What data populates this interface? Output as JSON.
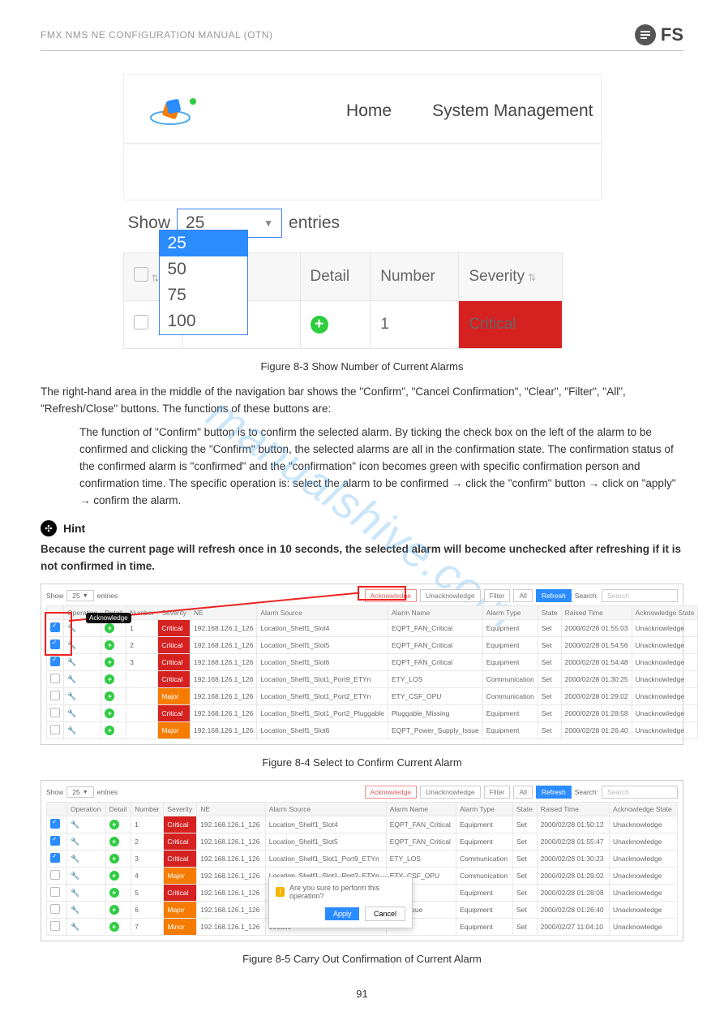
{
  "header": {
    "title": "FMX NMS NE CONFIGURATION MANUAL (OTN)",
    "brand": "FS"
  },
  "fig3": {
    "nav": {
      "home": "Home",
      "system": "System Management"
    },
    "show": {
      "prefix": "Show",
      "suffix": "entries",
      "selected": "25",
      "options": [
        "25",
        "50",
        "75",
        "100"
      ]
    },
    "table": {
      "headers": {
        "op": "on",
        "detail": "Detail",
        "number": "Number",
        "severity": "Severity"
      },
      "row": {
        "number": "1",
        "severity": "Critical"
      }
    },
    "caption": "Figure 8-3 Show Number of Current Alarms"
  },
  "para1": "The right-hand area in the middle of the navigation bar shows the \"Confirm\", \"Cancel Confirmation\", \"Clear\", \"Filter\", \"All\", \"Refresh/Close\" buttons. The functions of these buttons are:",
  "para2": "The function of \"Confirm\" button is to confirm the selected alarm. By ticking the check box on the left of the alarm to be confirmed and clicking the \"Confirm\" button, the selected alarms are all in the confirmation state. The confirmation status of the confirmed alarm is \"confirmed\" and the \"confirmation\" icon becomes green with specific confirmation person and confirmation time. The specific operation is: select the alarm to be confirmed → click the \"confirm\" button → click on \"apply\" → confirm the alarm.",
  "hint": {
    "label": "Hint",
    "text": "Because the current page will refresh once in 10 seconds, the selected alarm will become unchecked after refreshing if it is not confirmed in time."
  },
  "toolbar": {
    "show": "Show",
    "entries": "entries",
    "sel": "25",
    "ack": "Acknowledge",
    "unack": "Unacknowledge",
    "filter": "Filter",
    "all": "All",
    "refresh": "Refresh",
    "search": "Search:",
    "ph": "Search"
  },
  "wheaders": [
    "",
    "Operation",
    "Detail",
    "Number",
    "Severity",
    "NE",
    "Alarm Source",
    "Alarm Name",
    "Alarm Type",
    "State",
    "Raised Time",
    "Acknowledge State"
  ],
  "tooltip": "Acknowledge",
  "fig4": {
    "rows": [
      {
        "chk": true,
        "num": "1",
        "sev": "Critical",
        "sc": "sev-critical",
        "ne": "192.168.126.1_126",
        "src": "Location_Shelf1_Slot4",
        "name": "EQPT_FAN_Critical",
        "type": "Equipment",
        "state": "Set",
        "time": "2000/02/28 01:55:03",
        "ack": "Unacknowledge"
      },
      {
        "chk": true,
        "num": "2",
        "sev": "Critical",
        "sc": "sev-critical",
        "ne": "192.168.126.1_126",
        "src": "Location_Shelf1_Slot5",
        "name": "EQPT_FAN_Critical",
        "type": "Equipment",
        "state": "Set",
        "time": "2000/02/28 01:54:56",
        "ack": "Unacknowledge"
      },
      {
        "chk": true,
        "num": "3",
        "sev": "Critical",
        "sc": "sev-critical",
        "ne": "192.168.126.1_126",
        "src": "Location_Shelf1_Slot6",
        "name": "EQPT_FAN_Critical",
        "type": "Equipment",
        "state": "Set",
        "time": "2000/02/28 01:54:48",
        "ack": "Unacknowledge"
      },
      {
        "chk": false,
        "num": "",
        "sev": "Critical",
        "sc": "sev-critical",
        "ne": "192.168.126.1_126",
        "src": "Location_Shelf1_Slot1_Port9_ETYn",
        "name": "ETY_LOS",
        "type": "Communication",
        "state": "Set",
        "time": "2000/02/28 01:30:25",
        "ack": "Unacknowledge"
      },
      {
        "chk": false,
        "num": "",
        "sev": "Major",
        "sc": "sev-major",
        "ne": "192.168.126.1_126",
        "src": "Location_Shelf1_Slot1_Port2_ETYn",
        "name": "ETY_CSF_OPU",
        "type": "Communication",
        "state": "Set",
        "time": "2000/02/28 01:29:02",
        "ack": "Unacknowledge"
      },
      {
        "chk": false,
        "num": "",
        "sev": "Critical",
        "sc": "sev-critical",
        "ne": "192.168.126.1_126",
        "src": "Location_Shelf1_Slot1_Port2_Pluggable",
        "name": "Pluggable_Missing",
        "type": "Equipment",
        "state": "Set",
        "time": "2000/02/28 01:28:58",
        "ack": "Unacknowledge"
      },
      {
        "chk": false,
        "num": "",
        "sev": "Major",
        "sc": "sev-major",
        "ne": "192.168.126.1_126",
        "src": "Location_Shelf1_Slot6",
        "name": "EQPT_Power_Supply_Issue",
        "type": "Equipment",
        "state": "Set",
        "time": "2000/02/28 01:26:40",
        "ack": "Unacknowledge"
      }
    ],
    "caption": "Figure 8-4 Select to Confirm Current Alarm"
  },
  "fig5": {
    "rows": [
      {
        "chk": true,
        "num": "1",
        "sev": "Critical",
        "sc": "sev-critical",
        "ne": "192.168.126.1_126",
        "src": "Location_Shelf1_Slot4",
        "name": "EQPT_FAN_Critical",
        "type": "Equipment",
        "state": "Set",
        "time": "2000/02/28 01:50:12",
        "ack": "Unacknowledge"
      },
      {
        "chk": true,
        "num": "2",
        "sev": "Critical",
        "sc": "sev-critical",
        "ne": "192.168.126.1_126",
        "src": "Location_Shelf1_Slot5",
        "name": "EQPT_FAN_Critical",
        "type": "Equipment",
        "state": "Set",
        "time": "2000/02/28 01:55:47",
        "ack": "Unacknowledge"
      },
      {
        "chk": true,
        "num": "3",
        "sev": "Critical",
        "sc": "sev-critical",
        "ne": "192.168.126.1_126",
        "src": "Location_Shelf1_Slot1_Port9_ETYn",
        "name": "ETY_LOS",
        "type": "Communication",
        "state": "Set",
        "time": "2000/02/28 01:30:23",
        "ack": "Unacknowledge"
      },
      {
        "chk": false,
        "num": "4",
        "sev": "Major",
        "sc": "sev-major",
        "ne": "192.168.126.1_126",
        "src": "Location_Shelf1_Slot1_Port2_ETYn",
        "name": "ETY_CSF_OPU",
        "type": "Communication",
        "state": "Set",
        "time": "2000/02/28 01:29:02",
        "ack": "Unacknowledge"
      },
      {
        "chk": false,
        "num": "5",
        "sev": "Critical",
        "sc": "sev-critical",
        "ne": "192.168.126.1_126",
        "src": "Locatio",
        "name": "ing",
        "type": "Equipment",
        "state": "Set",
        "time": "2000/02/28 01:28:08",
        "ack": "Unacknowledge"
      },
      {
        "chk": false,
        "num": "6",
        "sev": "Major",
        "sc": "sev-major",
        "ne": "192.168.126.1_126",
        "src": "Locatio",
        "name": "pply_Issue",
        "type": "Equipment",
        "state": "Set",
        "time": "2000/02/28 01:26:40",
        "ack": "Unacknowledge"
      },
      {
        "chk": false,
        "num": "7",
        "sev": "Minor",
        "sc": "sev-major",
        "ne": "192.168.126.1_126",
        "src": "Locatio",
        "name": "",
        "type": "Equipment",
        "state": "Set",
        "time": "2000/02/27 11:04:10",
        "ack": "Unacknowledge"
      }
    ],
    "modal": {
      "msg": "Are you sure to perform this operation?",
      "apply": "Apply",
      "cancel": "Cancel"
    },
    "caption": "Figure 8-5 Carry Out Confirmation of Current Alarm"
  },
  "watermark": "manualshive.com",
  "pagenum": "91"
}
